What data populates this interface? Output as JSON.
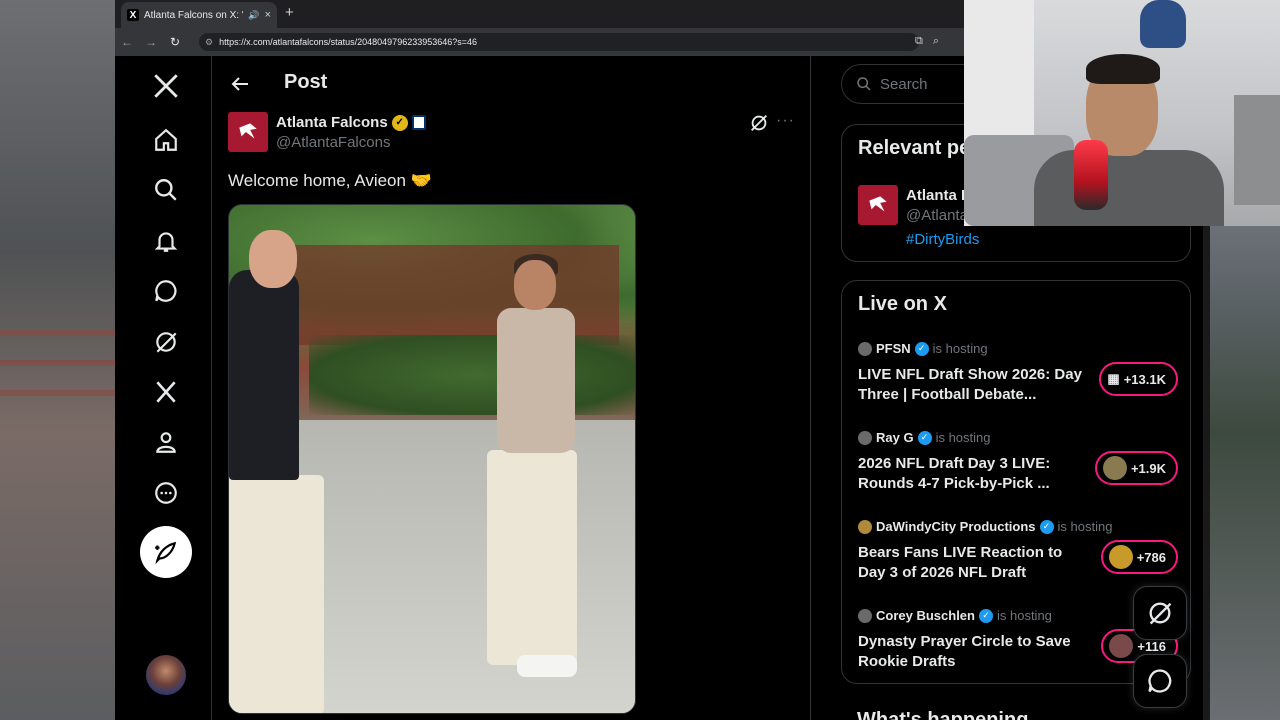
{
  "browser": {
    "tab_title": "Atlanta Falcons on X: \"Welc",
    "url": "https://x.com/atlantafalcons/status/2048049796233953646?s=46",
    "new_tab": "+",
    "close": "×"
  },
  "nav": {
    "items": [
      "x-logo",
      "home",
      "explore",
      "notifications",
      "messages",
      "grok",
      "premium",
      "profile",
      "more"
    ],
    "post_button_icon": "compose-feather-icon"
  },
  "header": {
    "title": "Post"
  },
  "tweet": {
    "author_name": "Atlanta Falcons",
    "author_handle": "@AtlantaFalcons",
    "text": "Welcome home, Avieon 🤝",
    "more": "···"
  },
  "search": {
    "placeholder": "Search"
  },
  "relevant": {
    "title": "Relevant people",
    "name": "Atlanta Falcons",
    "handle": "@AtlantaFalcons",
    "hashtag": "#DirtyBirds"
  },
  "live": {
    "title": "Live on X",
    "items": [
      {
        "host": "PFSN",
        "status": "is hosting",
        "title": "LIVE NFL Draft Show 2026: Day Three | Football Debate...",
        "count": "+13.1K"
      },
      {
        "host": "Ray G",
        "status": "is hosting",
        "title": "2026 NFL Draft Day 3 LIVE: Rounds 4-7 Pick-by-Pick ...",
        "count": "+1.9K"
      },
      {
        "host": "DaWindyCity Productions",
        "status": "is hosting",
        "title": "Bears Fans LIVE Reaction to Day 3 of 2026 NFL Draft",
        "count": "+786"
      },
      {
        "host": "Corey Buschlen",
        "status": "is hosting",
        "title": "Dynasty Prayer Circle to Save Rookie Drafts",
        "count": "+116"
      }
    ]
  },
  "whats_happening": "What's happening",
  "colors": {
    "accent": "#1d9bf0",
    "live_ring": "#f91880",
    "falcons_red": "#a71930",
    "gold_badge": "#e2b719"
  }
}
